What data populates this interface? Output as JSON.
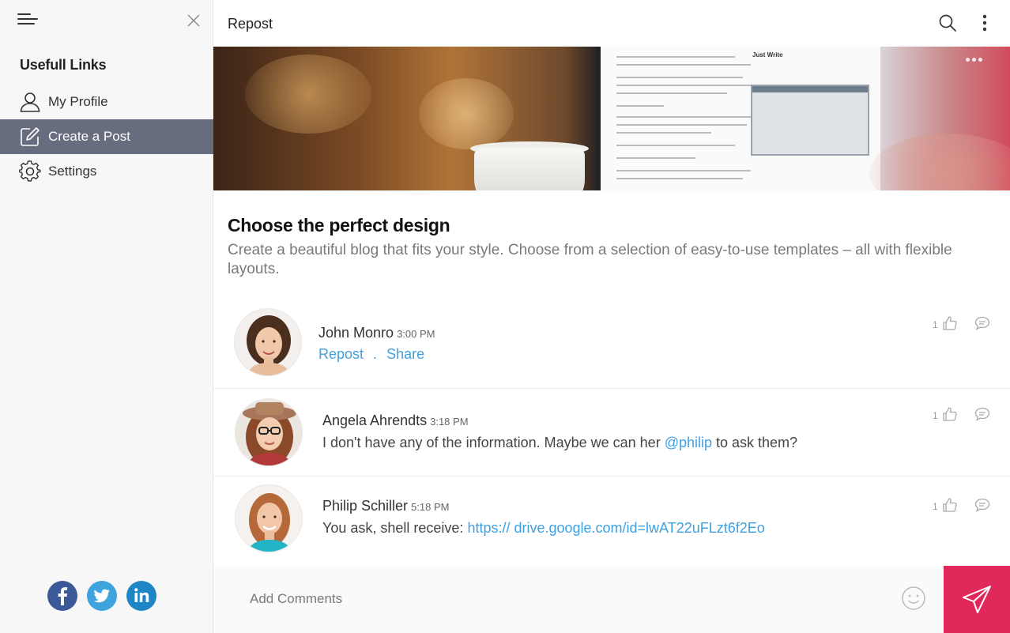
{
  "sidebar": {
    "title": "Usefull Links",
    "items": [
      {
        "label": "My Profile"
      },
      {
        "label": "Create a Post"
      },
      {
        "label": "Settings"
      }
    ],
    "active_index": 1,
    "socials": [
      {
        "name": "facebook",
        "color": "#3b5998"
      },
      {
        "name": "twitter",
        "color": "#3fa3dd"
      },
      {
        "name": "linkedin",
        "color": "#1f86c6"
      }
    ]
  },
  "header": {
    "title": "Repost"
  },
  "hero": {
    "screen_heading": "Just Write"
  },
  "article": {
    "title": "Choose the perfect design",
    "description": "Create a beautiful blog that fits your style. Choose from a selection of easy-to-use templates – all with flexible layouts."
  },
  "comments": [
    {
      "name": "John Monro",
      "time": "3:00 PM",
      "actions": [
        "Repost",
        "Share"
      ],
      "separator": ".",
      "likes": "1"
    },
    {
      "name": "Angela Ahrendts",
      "time": "3:18 PM",
      "text_before": "I don't have any of the information. Maybe we can her ",
      "mention": "@philip",
      "text_after": " to ask them?",
      "likes": "1"
    },
    {
      "name": "Philip Schiller",
      "time": "5:18 PM",
      "text_before": "You ask, shell receive: ",
      "link": "https:// drive.google.com/id=lwAT22uFLzt6f2Eo",
      "likes": "1"
    }
  ],
  "footer": {
    "placeholder": "Add Comments"
  },
  "colors": {
    "accent": "#e0295a",
    "link": "#3ea0e0",
    "sidebar_active": "#676d7e"
  }
}
